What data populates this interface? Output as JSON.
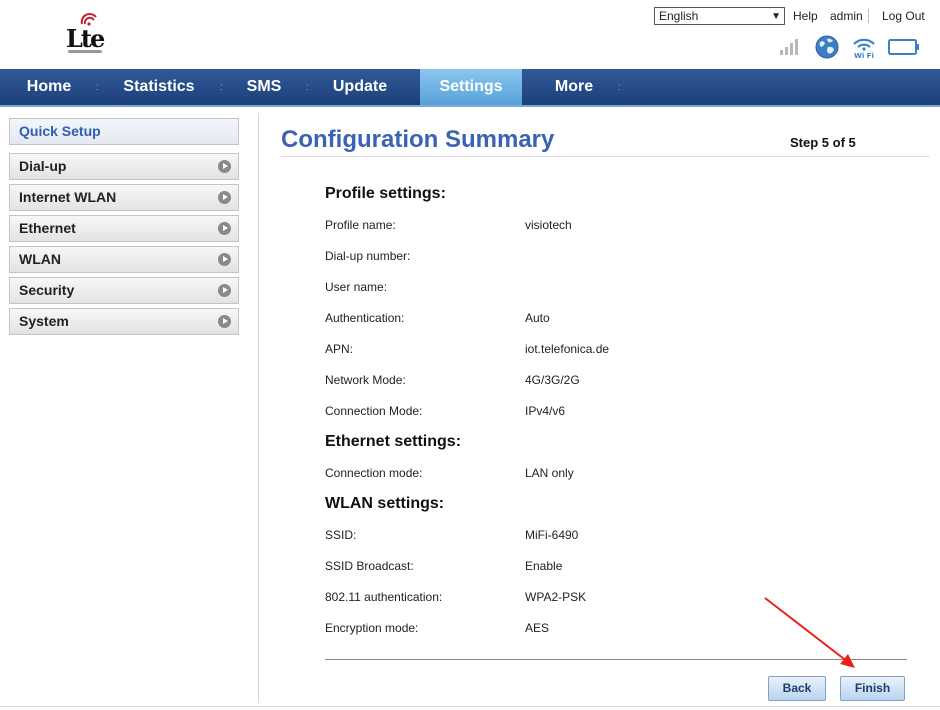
{
  "header": {
    "logo_text": "Lte",
    "language": {
      "selected": "English"
    },
    "links": {
      "help": "Help",
      "user": "admin",
      "logout": "Log Out"
    },
    "status_icons": [
      "signal-icon",
      "globe-icon",
      "wifi-icon",
      "battery-icon"
    ],
    "wifi_icon_text": "Wi Fi"
  },
  "nav": {
    "items": [
      {
        "label": "Home"
      },
      {
        "label": "Statistics"
      },
      {
        "label": "SMS"
      },
      {
        "label": "Update"
      },
      {
        "label": "Settings",
        "active": true
      },
      {
        "label": "More"
      }
    ]
  },
  "sidebar": {
    "items": [
      {
        "label": "Quick Setup",
        "active": true
      },
      {
        "label": "Dial-up"
      },
      {
        "label": "Internet WLAN"
      },
      {
        "label": "Ethernet"
      },
      {
        "label": "WLAN"
      },
      {
        "label": "Security"
      },
      {
        "label": "System"
      }
    ]
  },
  "main": {
    "title": "Configuration Summary",
    "step": "Step 5 of 5",
    "sections": [
      {
        "heading": "Profile settings:",
        "rows": [
          {
            "label": "Profile name:",
            "value": "visiotech"
          },
          {
            "label": "Dial-up number:",
            "value": ""
          },
          {
            "label": "User name:",
            "value": ""
          },
          {
            "label": "Authentication:",
            "value": "Auto"
          },
          {
            "label": "APN:",
            "value": "iot.telefonica.de"
          },
          {
            "label": "Network Mode:",
            "value": "4G/3G/2G"
          },
          {
            "label": "Connection Mode:",
            "value": "IPv4/v6"
          }
        ]
      },
      {
        "heading": "Ethernet settings:",
        "rows": [
          {
            "label": "Connection mode:",
            "value": "LAN only"
          }
        ]
      },
      {
        "heading": "WLAN settings:",
        "rows": [
          {
            "label": "SSID:",
            "value": "MiFi-6490"
          },
          {
            "label": "SSID Broadcast:",
            "value": "Enable"
          },
          {
            "label": "802.11 authentication:",
            "value": "WPA2-PSK"
          },
          {
            "label": "Encryption mode:",
            "value": "AES"
          }
        ]
      }
    ],
    "buttons": {
      "back": "Back",
      "finish": "Finish"
    }
  },
  "colors": {
    "nav_bg": "#1d3f77",
    "nav_active": "#56a1d9",
    "title": "#3a63b3",
    "annotation_arrow": "#e8231b"
  }
}
